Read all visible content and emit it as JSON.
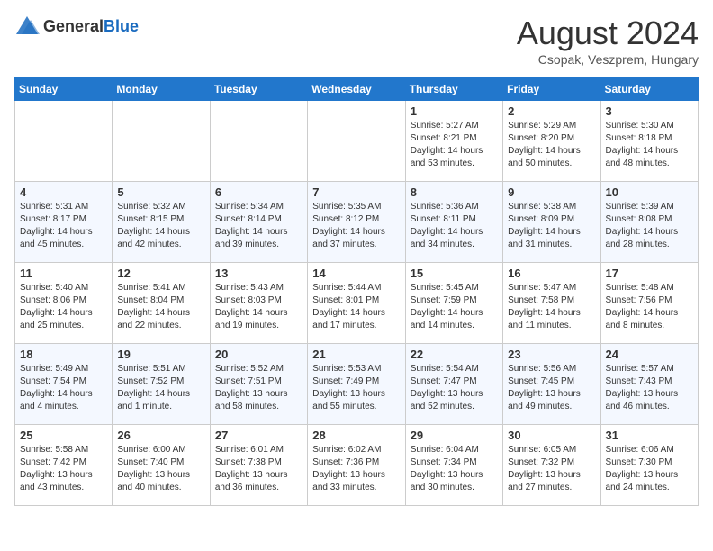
{
  "header": {
    "logo_general": "General",
    "logo_blue": "Blue",
    "month_title": "August 2024",
    "location": "Csopak, Veszprem, Hungary"
  },
  "weekdays": [
    "Sunday",
    "Monday",
    "Tuesday",
    "Wednesday",
    "Thursday",
    "Friday",
    "Saturday"
  ],
  "weeks": [
    [
      {
        "day": "",
        "info": ""
      },
      {
        "day": "",
        "info": ""
      },
      {
        "day": "",
        "info": ""
      },
      {
        "day": "",
        "info": ""
      },
      {
        "day": "1",
        "info": "Sunrise: 5:27 AM\nSunset: 8:21 PM\nDaylight: 14 hours\nand 53 minutes."
      },
      {
        "day": "2",
        "info": "Sunrise: 5:29 AM\nSunset: 8:20 PM\nDaylight: 14 hours\nand 50 minutes."
      },
      {
        "day": "3",
        "info": "Sunrise: 5:30 AM\nSunset: 8:18 PM\nDaylight: 14 hours\nand 48 minutes."
      }
    ],
    [
      {
        "day": "4",
        "info": "Sunrise: 5:31 AM\nSunset: 8:17 PM\nDaylight: 14 hours\nand 45 minutes."
      },
      {
        "day": "5",
        "info": "Sunrise: 5:32 AM\nSunset: 8:15 PM\nDaylight: 14 hours\nand 42 minutes."
      },
      {
        "day": "6",
        "info": "Sunrise: 5:34 AM\nSunset: 8:14 PM\nDaylight: 14 hours\nand 39 minutes."
      },
      {
        "day": "7",
        "info": "Sunrise: 5:35 AM\nSunset: 8:12 PM\nDaylight: 14 hours\nand 37 minutes."
      },
      {
        "day": "8",
        "info": "Sunrise: 5:36 AM\nSunset: 8:11 PM\nDaylight: 14 hours\nand 34 minutes."
      },
      {
        "day": "9",
        "info": "Sunrise: 5:38 AM\nSunset: 8:09 PM\nDaylight: 14 hours\nand 31 minutes."
      },
      {
        "day": "10",
        "info": "Sunrise: 5:39 AM\nSunset: 8:08 PM\nDaylight: 14 hours\nand 28 minutes."
      }
    ],
    [
      {
        "day": "11",
        "info": "Sunrise: 5:40 AM\nSunset: 8:06 PM\nDaylight: 14 hours\nand 25 minutes."
      },
      {
        "day": "12",
        "info": "Sunrise: 5:41 AM\nSunset: 8:04 PM\nDaylight: 14 hours\nand 22 minutes."
      },
      {
        "day": "13",
        "info": "Sunrise: 5:43 AM\nSunset: 8:03 PM\nDaylight: 14 hours\nand 19 minutes."
      },
      {
        "day": "14",
        "info": "Sunrise: 5:44 AM\nSunset: 8:01 PM\nDaylight: 14 hours\nand 17 minutes."
      },
      {
        "day": "15",
        "info": "Sunrise: 5:45 AM\nSunset: 7:59 PM\nDaylight: 14 hours\nand 14 minutes."
      },
      {
        "day": "16",
        "info": "Sunrise: 5:47 AM\nSunset: 7:58 PM\nDaylight: 14 hours\nand 11 minutes."
      },
      {
        "day": "17",
        "info": "Sunrise: 5:48 AM\nSunset: 7:56 PM\nDaylight: 14 hours\nand 8 minutes."
      }
    ],
    [
      {
        "day": "18",
        "info": "Sunrise: 5:49 AM\nSunset: 7:54 PM\nDaylight: 14 hours\nand 4 minutes."
      },
      {
        "day": "19",
        "info": "Sunrise: 5:51 AM\nSunset: 7:52 PM\nDaylight: 14 hours\nand 1 minute."
      },
      {
        "day": "20",
        "info": "Sunrise: 5:52 AM\nSunset: 7:51 PM\nDaylight: 13 hours\nand 58 minutes."
      },
      {
        "day": "21",
        "info": "Sunrise: 5:53 AM\nSunset: 7:49 PM\nDaylight: 13 hours\nand 55 minutes."
      },
      {
        "day": "22",
        "info": "Sunrise: 5:54 AM\nSunset: 7:47 PM\nDaylight: 13 hours\nand 52 minutes."
      },
      {
        "day": "23",
        "info": "Sunrise: 5:56 AM\nSunset: 7:45 PM\nDaylight: 13 hours\nand 49 minutes."
      },
      {
        "day": "24",
        "info": "Sunrise: 5:57 AM\nSunset: 7:43 PM\nDaylight: 13 hours\nand 46 minutes."
      }
    ],
    [
      {
        "day": "25",
        "info": "Sunrise: 5:58 AM\nSunset: 7:42 PM\nDaylight: 13 hours\nand 43 minutes."
      },
      {
        "day": "26",
        "info": "Sunrise: 6:00 AM\nSunset: 7:40 PM\nDaylight: 13 hours\nand 40 minutes."
      },
      {
        "day": "27",
        "info": "Sunrise: 6:01 AM\nSunset: 7:38 PM\nDaylight: 13 hours\nand 36 minutes."
      },
      {
        "day": "28",
        "info": "Sunrise: 6:02 AM\nSunset: 7:36 PM\nDaylight: 13 hours\nand 33 minutes."
      },
      {
        "day": "29",
        "info": "Sunrise: 6:04 AM\nSunset: 7:34 PM\nDaylight: 13 hours\nand 30 minutes."
      },
      {
        "day": "30",
        "info": "Sunrise: 6:05 AM\nSunset: 7:32 PM\nDaylight: 13 hours\nand 27 minutes."
      },
      {
        "day": "31",
        "info": "Sunrise: 6:06 AM\nSunset: 7:30 PM\nDaylight: 13 hours\nand 24 minutes."
      }
    ]
  ]
}
